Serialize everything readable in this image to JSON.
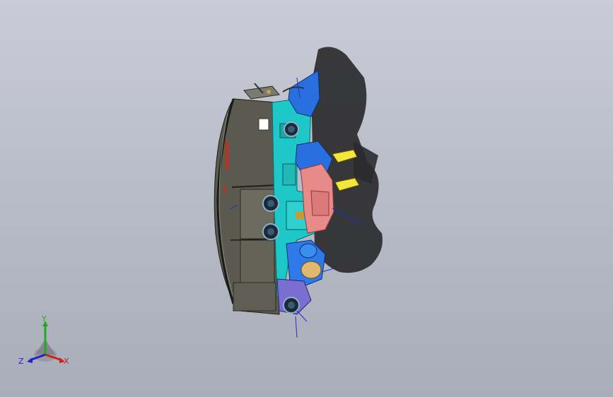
{
  "viewport": {
    "background_top": "#c9ccd6",
    "background_bottom": "#a9adb8",
    "model_colors": {
      "housing_dark": "#5a5a50",
      "duct_cyan": "#1fc8c8",
      "duct_blue": "#2a6fe0",
      "duct_salmon": "#e88a88",
      "duct_purple": "#7a6fd0",
      "label_yellow": "#f5e63a",
      "shadow": "#2b2b2e"
    }
  },
  "triad": {
    "y_label": "Y",
    "z_label": "Z",
    "x_label": "X",
    "y_color": "#22aa22",
    "z_color": "#2222cc",
    "x_color": "#cc2222"
  }
}
